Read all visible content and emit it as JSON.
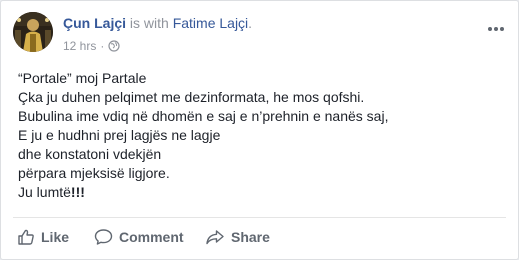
{
  "post": {
    "author": "Çun Lajçi",
    "with_text": "is with",
    "tagged": "Fatime Lajçi",
    "tagged_suffix": ".",
    "time": "12 hrs",
    "separator": "·",
    "lines": [
      "“Portale” moj Partale",
      "Çka ju duhen pelqimet me dezinformata, he mos qofshi.",
      "Bubulina ime vdiq në dhomën e saj e n’prehnin e nanës saj,",
      "E ju e hudhni prej lagjës ne lagje",
      "dhe konstatoni vdekjën",
      "përpara mjeksisë ligjore."
    ],
    "last_line_plain": "Ju lumtë",
    "last_line_bold": "!!!"
  },
  "actions": {
    "like": "Like",
    "comment": "Comment",
    "share": "Share"
  },
  "icons": {
    "menu": "more-horizontal-icon",
    "privacy": "globe-icon",
    "like": "thumbs-up-icon",
    "comment": "comment-bubble-icon",
    "share": "share-arrow-icon"
  },
  "colors": {
    "link": "#365899",
    "meta": "#90949c",
    "text": "#1d2129",
    "action": "#606770"
  }
}
